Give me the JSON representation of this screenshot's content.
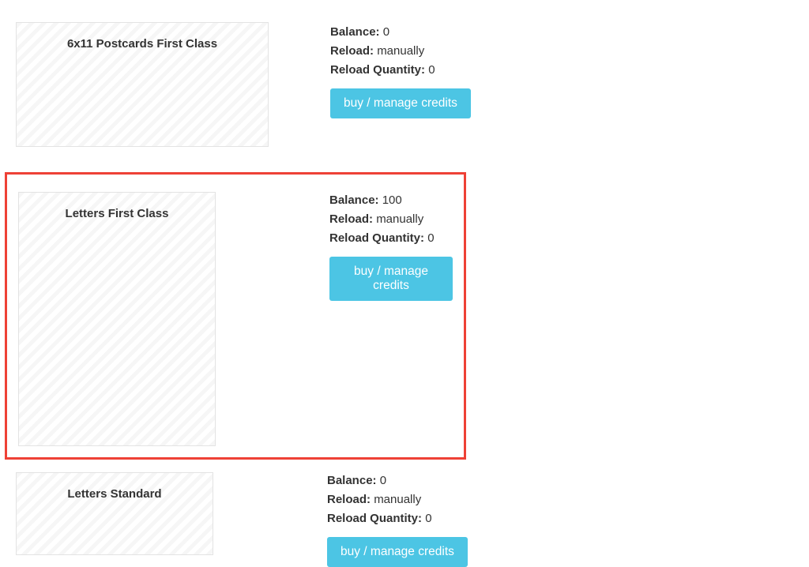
{
  "labels": {
    "balance": "Balance:",
    "reload": "Reload:",
    "reload_qty": "Reload Quantity:",
    "buy_manage": "buy / manage credits"
  },
  "cards": [
    {
      "title": "6x11 Postcards First Class",
      "balance": "0",
      "reload": "manually",
      "reload_qty": "0"
    },
    {
      "title": "Letters First Class",
      "balance": "100",
      "reload": "manually",
      "reload_qty": "0"
    },
    {
      "title": "Letters Standard",
      "balance": "0",
      "reload": "manually",
      "reload_qty": "0"
    }
  ]
}
